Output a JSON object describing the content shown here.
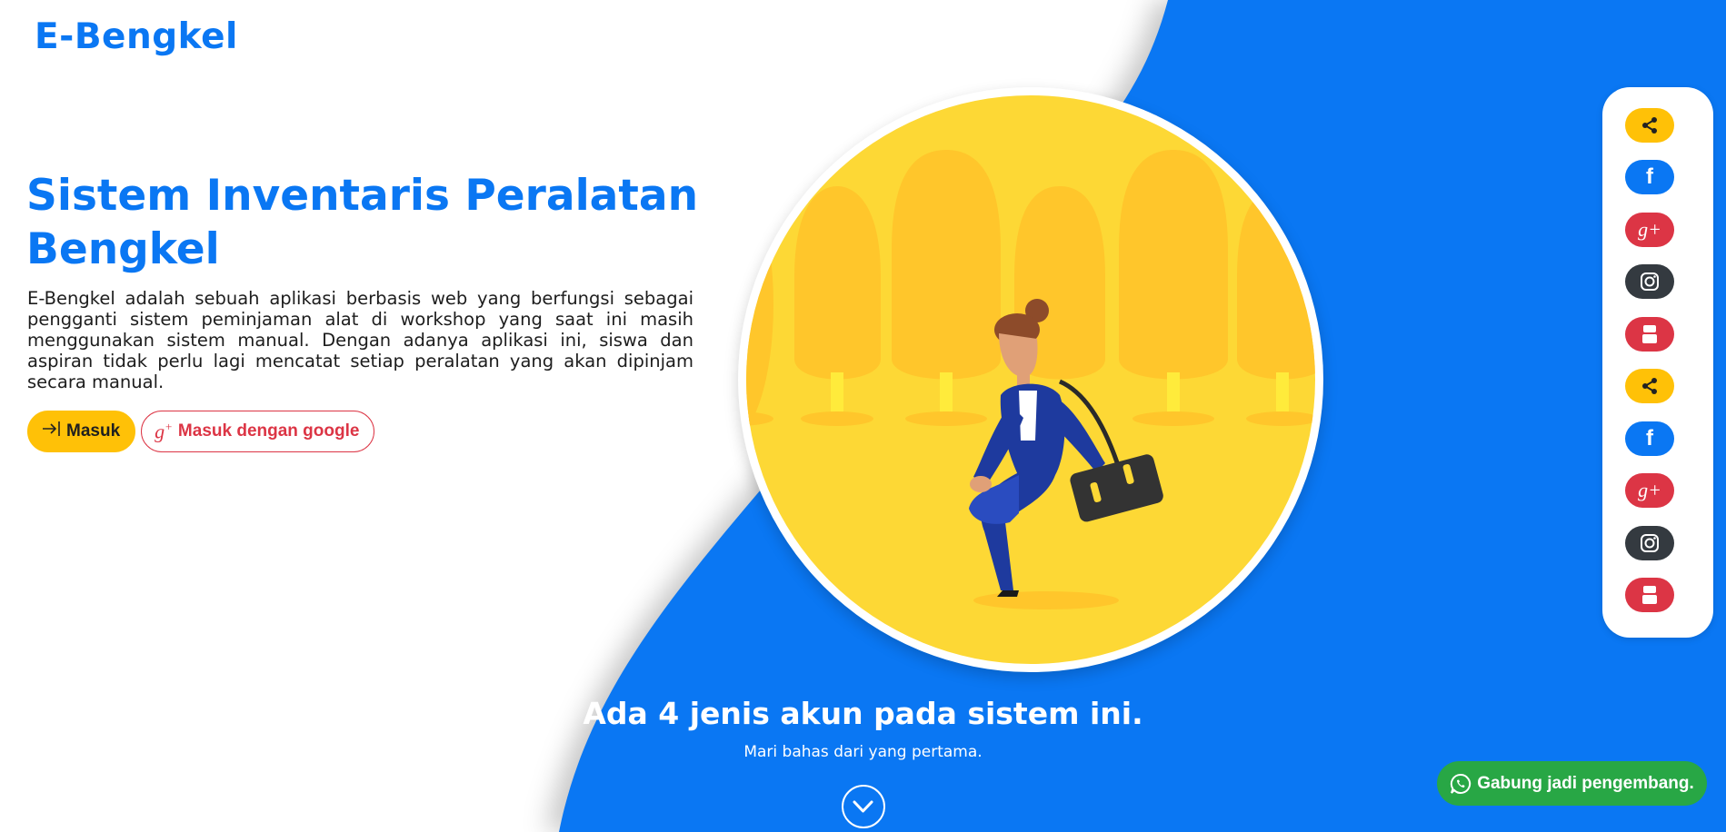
{
  "brand": {
    "logo": "E-Bengkel"
  },
  "colors": {
    "primary": "#0a77f3",
    "warning": "#ffc107",
    "danger": "#dc3545",
    "dark": "#343a40",
    "success": "#28a745"
  },
  "hero": {
    "title": "Sistem Inventaris Peralatan Bengkel",
    "description": "E-Bengkel adalah sebuah aplikasi berbasis web yang berfungsi sebagai pengganti sistem peminjaman alat di workshop yang saat ini masih menggunakan sistem manual. Dengan adanya aplikasi ini, siswa dan aspiran tidak perlu lagi mencatat setiap peralatan yang akan dipinjam secara manual.",
    "login_button": {
      "icon": "sign-in-icon",
      "label": "Masuk"
    },
    "google_button": {
      "icon": "google-plus-icon",
      "icon_text": "g",
      "icon_sup": "+",
      "label": "Masuk dengan google"
    }
  },
  "illustration": {
    "subject": "woman-walking-with-bag-illustration"
  },
  "social": {
    "items": [
      {
        "icon": "share-icon"
      },
      {
        "icon": "facebook-icon",
        "text": "f"
      },
      {
        "icon": "google-plus-icon",
        "text": "g+"
      },
      {
        "icon": "instagram-icon"
      },
      {
        "icon": "youtube-icon"
      },
      {
        "icon": "share-icon"
      },
      {
        "icon": "facebook-icon",
        "text": "f"
      },
      {
        "icon": "google-plus-icon",
        "text": "g+"
      },
      {
        "icon": "instagram-icon"
      },
      {
        "icon": "youtube-icon"
      }
    ]
  },
  "section": {
    "title": "Ada 4 jenis akun pada sistem ini.",
    "subtitle": "Mari bahas dari yang pertama.",
    "scroll_icon": "chevron-down-icon"
  },
  "whatsapp": {
    "icon": "whatsapp-icon",
    "label": "Gabung jadi pengembang."
  }
}
